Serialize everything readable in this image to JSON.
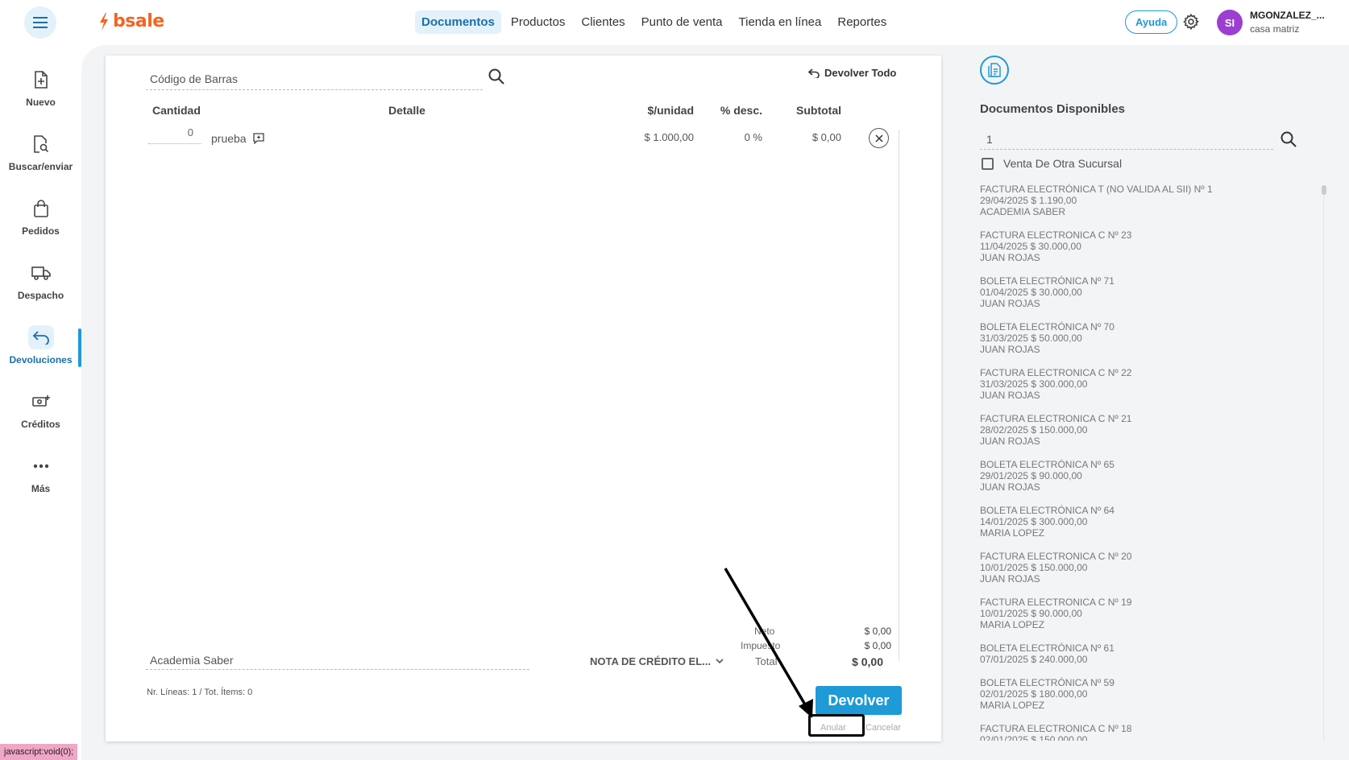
{
  "header": {
    "logo": "bsale",
    "nav": [
      "Documentos",
      "Productos",
      "Clientes",
      "Punto de venta",
      "Tienda en línea",
      "Reportes"
    ],
    "active_nav": "Documentos",
    "help_label": "Ayuda",
    "avatar_initials": "SI",
    "user_name": "MGONZALEZ_...",
    "user_branch": "casa matriz"
  },
  "sidebar": {
    "items": [
      {
        "label": "Nuevo",
        "icon": "file-plus-icon"
      },
      {
        "label": "Buscar/enviar",
        "icon": "file-search-icon"
      },
      {
        "label": "Pedidos",
        "icon": "shopping-bag-icon"
      },
      {
        "label": "Despacho",
        "icon": "truck-icon"
      },
      {
        "label": "Devoluciones",
        "icon": "return-arrow-icon"
      },
      {
        "label": "Créditos",
        "icon": "money-icon"
      },
      {
        "label": "Más",
        "icon": "more-dots-icon"
      }
    ],
    "active": "Devoluciones"
  },
  "returns": {
    "barcode_placeholder": "Código de Barras",
    "return_all_label": "Devolver Todo",
    "columns": {
      "quantity": "Cantidad",
      "detail": "Detalle",
      "unit_price": "$/unidad",
      "discount": "% desc.",
      "subtotal": "Subtotal"
    },
    "row": {
      "quantity": "0",
      "detail": "prueba",
      "unit_price": "$ 1.000,00",
      "discount": "0 %",
      "subtotal": "$ 0,00"
    },
    "totals": {
      "net_label": "Neto",
      "net_value": "$ 0,00",
      "tax_label": "Impuesto",
      "tax_value": "$ 0,00",
      "total_label": "Total",
      "total_value": "$ 0,00"
    },
    "client": "Academia Saber",
    "document_type": "NOTA DE CRÉDITO EL...",
    "summary": "Nr. Líneas: 1 / Tot. Ítems: 0",
    "submit_label": "Devolver",
    "void_label": "Anular",
    "cancel_label": "Cancelar"
  },
  "available_docs": {
    "title": "Documentos Disponibles",
    "search_value": "1",
    "other_branch_label": "Venta De Otra Sucursal",
    "items": [
      {
        "title": "FACTURA ELECTRÓNICA T (NO VALIDA AL SII) Nº 1",
        "info": "29/04/2025 $ 1.190,00",
        "client": "ACADEMIA SABER"
      },
      {
        "title": "FACTURA ELECTRONICA C Nº 23",
        "info": "11/04/2025 $ 30.000,00",
        "client": "JUAN ROJAS"
      },
      {
        "title": "BOLETA ELECTRÓNICA Nº 71",
        "info": "01/04/2025 $ 30.000,00",
        "client": "JUAN ROJAS"
      },
      {
        "title": "BOLETA ELECTRÓNICA Nº 70",
        "info": "31/03/2025 $ 50.000,00",
        "client": "JUAN ROJAS"
      },
      {
        "title": "FACTURA ELECTRONICA C Nº 22",
        "info": "31/03/2025 $ 300.000,00",
        "client": "JUAN ROJAS"
      },
      {
        "title": "FACTURA ELECTRONICA C Nº 21",
        "info": "28/02/2025 $ 150.000,00",
        "client": "JUAN ROJAS"
      },
      {
        "title": "BOLETA ELECTRÓNICA Nº 65",
        "info": "29/01/2025 $ 90.000,00",
        "client": "JUAN ROJAS"
      },
      {
        "title": "BOLETA ELECTRÓNICA Nº 64",
        "info": "14/01/2025 $ 300.000,00",
        "client": "MARIA LOPEZ"
      },
      {
        "title": "FACTURA ELECTRONICA C Nº 20",
        "info": "10/01/2025 $ 150.000,00",
        "client": "JUAN ROJAS"
      },
      {
        "title": "FACTURA ELECTRONICA C Nº 19",
        "info": "10/01/2025 $ 90.000,00",
        "client": "MARIA LOPEZ"
      },
      {
        "title": "BOLETA ELECTRÓNICA Nº 61",
        "info": "07/01/2025 $ 240.000,00",
        "client": ""
      },
      {
        "title": "BOLETA ELECTRÓNICA Nº 59",
        "info": "02/01/2025 $ 180.000,00",
        "client": "MARIA LOPEZ"
      },
      {
        "title": "FACTURA ELECTRONICA C Nº 18",
        "info": "02/01/2025 $ 150.000,00",
        "client": ""
      }
    ]
  },
  "status_bar": "javascript:void(0);",
  "colors": {
    "accent": "#1e9ad6",
    "brand": "#f26522",
    "avatar": "#9b3fd1",
    "active_bg": "#e3f1fb"
  }
}
